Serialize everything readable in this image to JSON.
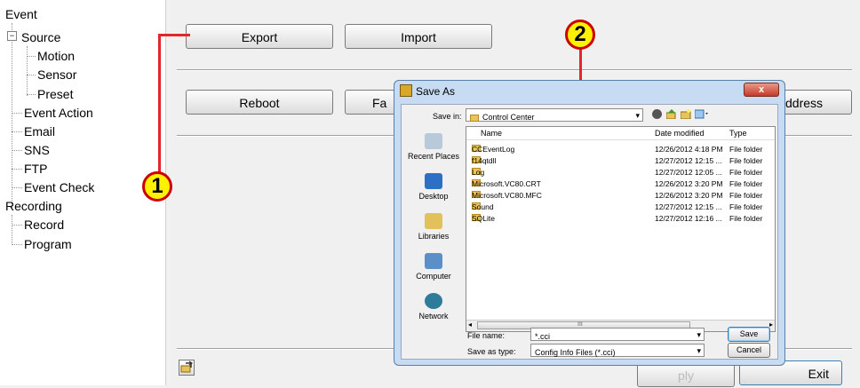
{
  "tree": {
    "event": "Event",
    "source": "Source",
    "motion": "Motion",
    "sensor": "Sensor",
    "preset": "Preset",
    "event_action": "Event Action",
    "email": "Email",
    "sns": "SNS",
    "ftp": "FTP",
    "event_check": "Event Check",
    "recording": "Recording",
    "record": "Record",
    "program": "Program",
    "collapse_glyph": "−"
  },
  "main": {
    "export": "Export",
    "import": "Import",
    "reboot": "Reboot",
    "factory_partial": "Fa",
    "address_partial": "ddress",
    "exit": "Exit",
    "apply_partial": "ply"
  },
  "callouts": {
    "one": "1",
    "two": "2",
    "color": "#e3262c"
  },
  "dialog": {
    "title": "Save As",
    "close": "x",
    "save_in_label": "Save in:",
    "save_in_value": "Control Center",
    "toolbar_icons": [
      "back-icon",
      "up-folder-icon",
      "new-folder-icon",
      "view-menu-icon"
    ],
    "places": [
      "Recent Places",
      "Desktop",
      "Libraries",
      "Computer",
      "Network"
    ],
    "columns": {
      "name": "Name",
      "date": "Date modified",
      "type": "Type"
    },
    "files": [
      {
        "name": "CCEventLog",
        "date": "12/26/2012 4:18 PM",
        "type": "File folder"
      },
      {
        "name": "f14qtdll",
        "date": "12/27/2012 12:15 ...",
        "type": "File folder"
      },
      {
        "name": "Log",
        "date": "12/27/2012 12:05 ...",
        "type": "File folder"
      },
      {
        "name": "Microsoft.VC80.CRT",
        "date": "12/26/2012 3:20 PM",
        "type": "File folder"
      },
      {
        "name": "Microsoft.VC80.MFC",
        "date": "12/26/2012 3:20 PM",
        "type": "File folder"
      },
      {
        "name": "Sound",
        "date": "12/27/2012 12:15 ...",
        "type": "File folder"
      },
      {
        "name": "SQLite",
        "date": "12/27/2012 12:16 ...",
        "type": "File folder"
      }
    ],
    "file_name_label": "File name:",
    "file_name_value": "*.cci",
    "save_as_type_label": "Save as type:",
    "save_as_type_value": "Config Info Files (*.cci)",
    "save": "Save",
    "cancel": "Cancel",
    "scroll_grip": "III"
  }
}
